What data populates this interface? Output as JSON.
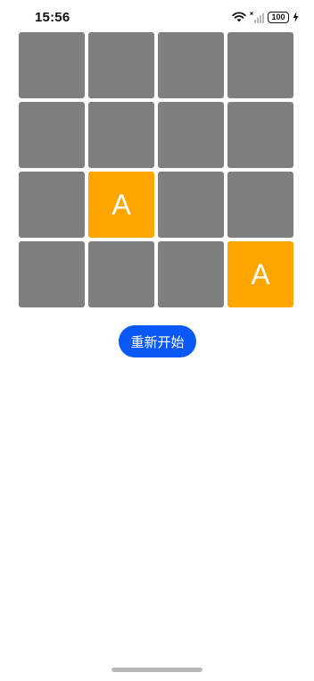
{
  "status_bar": {
    "time": "15:56",
    "battery_level": "100",
    "icons": [
      "wifi-icon",
      "signal-icon",
      "battery-icon",
      "charging-icon"
    ]
  },
  "board": {
    "rows": 4,
    "columns": 4,
    "cells": [
      {
        "text": "",
        "revealed": false
      },
      {
        "text": "",
        "revealed": false
      },
      {
        "text": "",
        "revealed": false
      },
      {
        "text": "",
        "revealed": false
      },
      {
        "text": "",
        "revealed": false
      },
      {
        "text": "",
        "revealed": false
      },
      {
        "text": "",
        "revealed": false
      },
      {
        "text": "",
        "revealed": false
      },
      {
        "text": "",
        "revealed": false
      },
      {
        "text": "A",
        "revealed": true
      },
      {
        "text": "",
        "revealed": false
      },
      {
        "text": "",
        "revealed": false
      },
      {
        "text": "",
        "revealed": false
      },
      {
        "text": "",
        "revealed": false
      },
      {
        "text": "",
        "revealed": false
      },
      {
        "text": "A",
        "revealed": true
      }
    ],
    "colors": {
      "hidden": "#7f7f7f",
      "revealed": "#ffa500",
      "letter": "#ffffff"
    }
  },
  "restart_button": {
    "label": "重新开始",
    "color": "#0a59f7"
  }
}
